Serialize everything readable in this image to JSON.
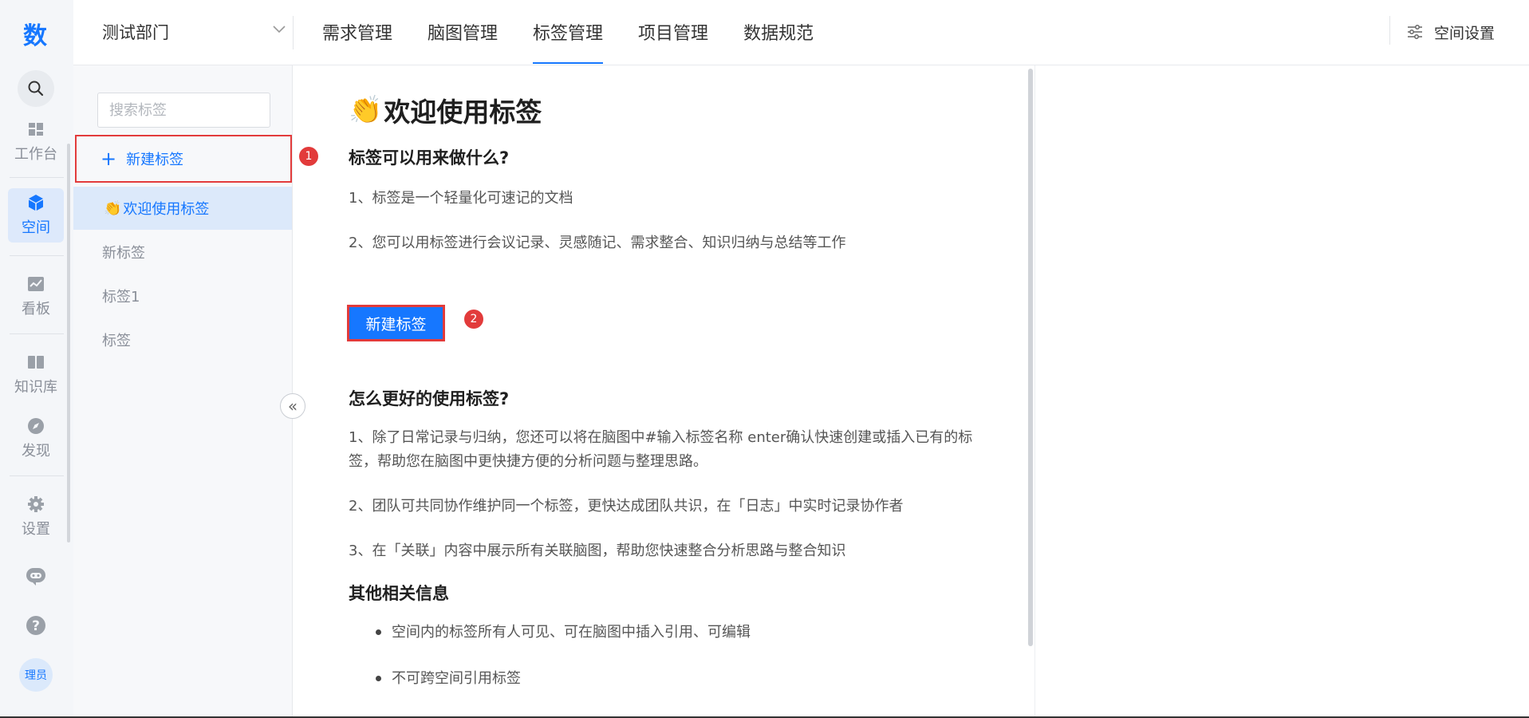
{
  "rail": {
    "logo": "数",
    "items": [
      {
        "label": "工作台",
        "icon": "dashboard-icon"
      },
      {
        "label": "空间",
        "icon": "cube-icon"
      },
      {
        "label": "看板",
        "icon": "chart-board-icon"
      },
      {
        "label": "知识库",
        "icon": "book-icon"
      },
      {
        "label": "发现",
        "icon": "compass-icon"
      },
      {
        "label": "设置",
        "icon": "gear-icon"
      }
    ],
    "avatar": "理员"
  },
  "header": {
    "department": "测试部门",
    "tabs": [
      "需求管理",
      "脑图管理",
      "标签管理",
      "项目管理",
      "数据规范"
    ],
    "active_tab": "标签管理",
    "space_settings": "空间设置"
  },
  "sidebar": {
    "search_placeholder": "搜索标签",
    "new_tag_label": "新建标签",
    "tags": [
      {
        "emoji": "👏",
        "label": "欢迎使用标签"
      },
      {
        "label": "新标签"
      },
      {
        "label": "标签1"
      },
      {
        "label": "标签"
      }
    ]
  },
  "badges": {
    "first": "1",
    "second": "2"
  },
  "doc": {
    "title_emoji": "👏",
    "title": "欢迎使用标签",
    "section1_title": "标签可以用来做什么?",
    "section1_p1": "1、标签是一个轻量化可速记的文档",
    "section1_p2": "2、您可以用标签进行会议记录、灵感随记、需求整合、知识归纳与总结等工作",
    "button_label": "新建标签",
    "section2_title": "怎么更好的使用标签?",
    "section2_p1": "1、除了日常记录与归纳，您还可以将在脑图中#输入标签名称 enter确认快速创建或插入已有的标签，帮助您在脑图中更快捷方便的分析问题与整理思路。",
    "section2_p2": "2、团队可共同协作维护同一个标签，更快达成团队共识，在「日志」中实时记录协作者",
    "section2_p3": "3、在「关联」内容中展示所有关联脑图，帮助您快速整合分析思路与整合知识",
    "section3_title": "其他相关信息",
    "bullets": [
      "空间内的标签所有人可见、可在脑图中插入引用、可编辑",
      "不可跨空间引用标签"
    ]
  },
  "colors": {
    "accent": "#1677ff",
    "highlight": "#e23b3b"
  }
}
